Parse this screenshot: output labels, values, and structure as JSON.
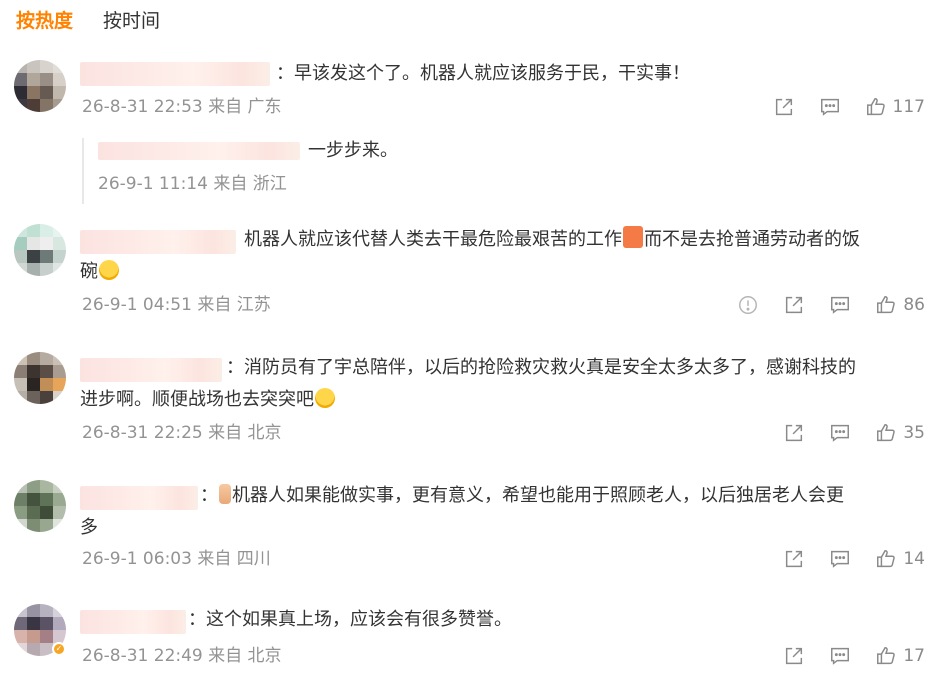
{
  "tabs": {
    "hot": "按热度",
    "time": "按时间"
  },
  "comments": [
    {
      "text": "：早该发这个了。机器人就应该服务于民，干实事！",
      "meta": "26-8-31 22:53 来自 广东",
      "likes": "117",
      "reply": {
        "text": "一步步来。",
        "meta": "26-9-1 11:14 来自 浙江"
      }
    },
    {
      "text_a": "机器人就应该代替人类去干最危险最艰苦的工作",
      "text_b": "而不是去抢普通劳动者的饭",
      "text_c": "碗",
      "meta": "26-9-1 04:51 来自 江苏",
      "likes": "86"
    },
    {
      "text_a": "：消防员有了宇总陪伴，以后的抢险救灾救火真是安全太多太多了，感谢科技的",
      "text_b": "进步啊。顺便战场也去突突吧",
      "meta": "26-8-31 22:25 来自 北京",
      "likes": "35"
    },
    {
      "text_a": "：",
      "text_b": "机器人如果能做实事，更有意义，希望也能用于照顾老人，以后独居老人会更",
      "text_c": "多",
      "meta": "26-9-1 06:03 来自 四川",
      "likes": "14"
    },
    {
      "text": "：这个如果真上场，应该会有很多赞誉。",
      "meta": "26-8-31 22:49 来自 北京",
      "likes": "17"
    }
  ],
  "icons": [
    "share-icon",
    "comment-icon",
    "like-icon",
    "report-icon"
  ],
  "colors": {
    "accent": "#ff8200",
    "text": "#333333",
    "meta": "#939393",
    "icon": "#8a8a8a"
  }
}
